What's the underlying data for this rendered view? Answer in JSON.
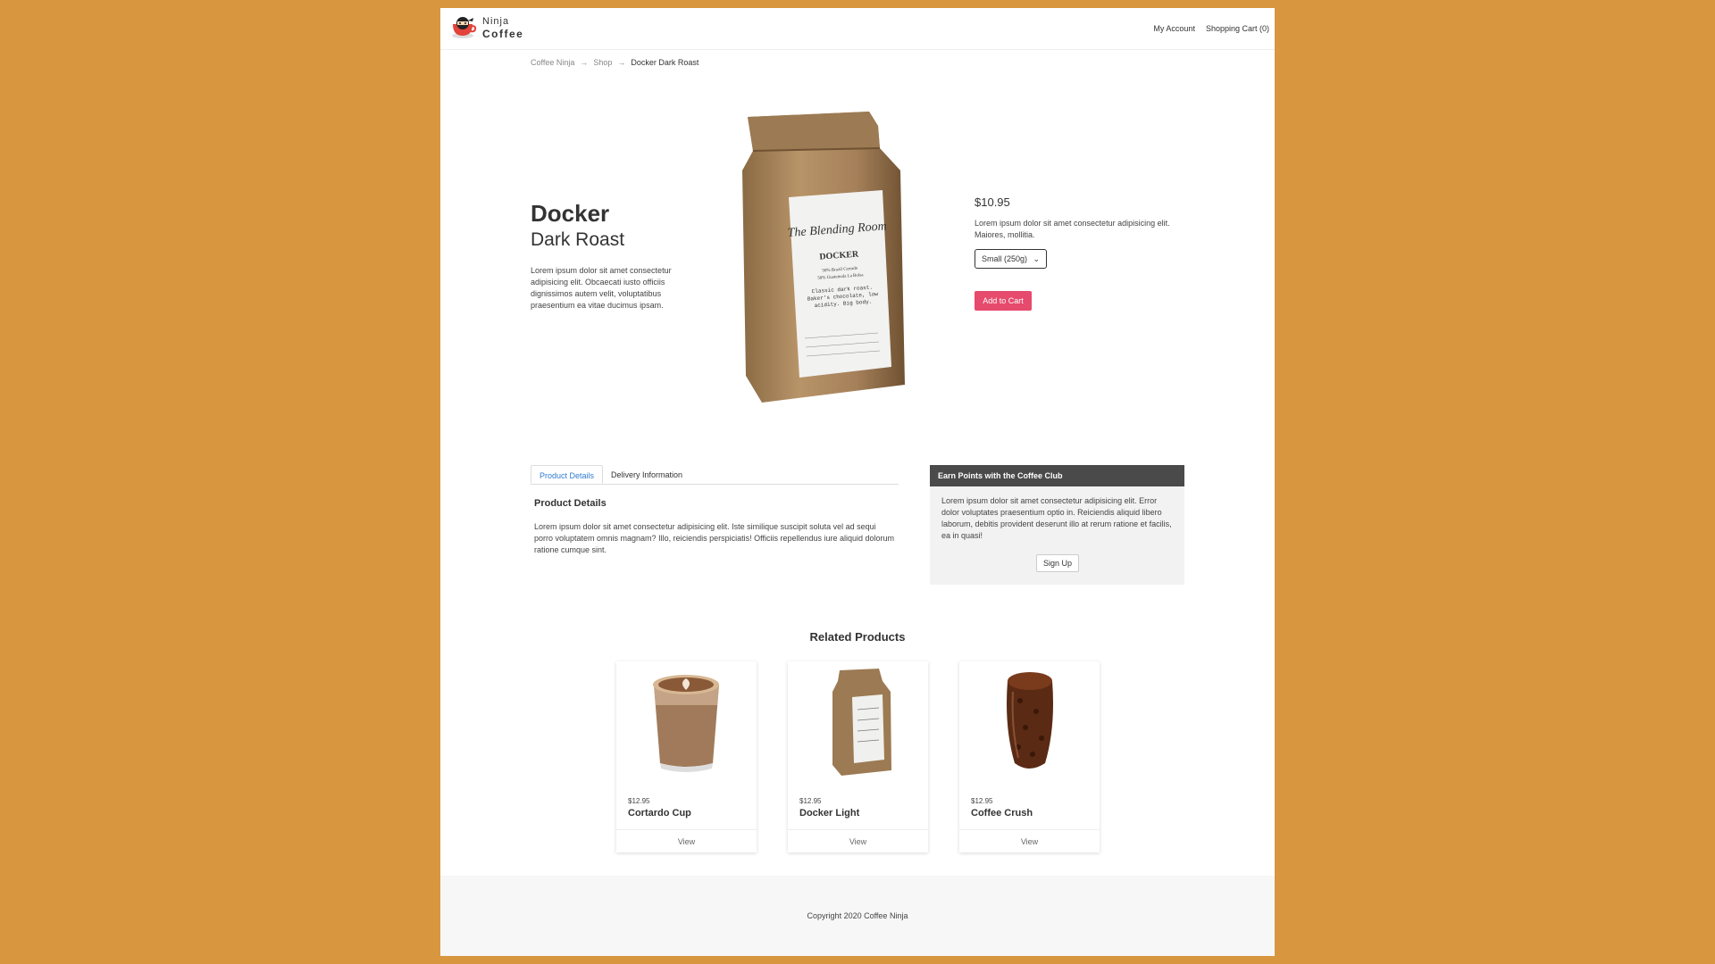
{
  "brand": {
    "line1": "Ninja",
    "line2": "Coffee"
  },
  "nav": {
    "account": "My Account",
    "cart": "Shopping Cart (0)"
  },
  "breadcrumb": {
    "home": "Coffee Ninja",
    "sep1": "→",
    "shop": "Shop",
    "sep2": "→",
    "current": "Docker Dark Roast"
  },
  "product": {
    "name_line1": "Docker",
    "name_line2": "Dark Roast",
    "description": "Lorem ipsum dolor sit amet consectetur adipisicing elit. Obcaecati iusto officiis dignissimos autem velit, voluptatibus praesentium ea vitae ducimus ipsam.",
    "price": "$10.95",
    "short_description": "Lorem ipsum dolor sit amet consectetur adipisicing elit. Maiores, mollitia.",
    "size_selected": "Small (250g)",
    "add_to_cart": "Add to Cart",
    "bag_label": {
      "script": "The Blending Room",
      "title": "DOCKER",
      "line1": "50% Brazil Cerrado",
      "line2": "50% Guatemala La Bolsa",
      "notes": "Classic dark roast. Baker's chocolate, low acidity. Big body."
    }
  },
  "tabs": {
    "details": "Product Details",
    "delivery": "Delivery Information"
  },
  "details": {
    "title": "Product Details",
    "text": "Lorem ipsum dolor sit amet consectetur adipisicing elit. Iste similique suscipit soluta vel ad sequi porro voluptatem omnis magnam? Illo, reiciendis perspiciatis! Officiis repellendus iure aliquid dolorum ratione cumque sint."
  },
  "club": {
    "title": "Earn Points with the Coffee Club",
    "text": "Lorem ipsum dolor sit amet consectetur adipisicing elit. Error dolor voluptates praesentium optio in. Reiciendis aliquid libero laborum, debitis provident deserunt illo at rerum ratione et facilis, ea in quasi!",
    "signup": "Sign Up"
  },
  "related": {
    "title": "Related Products",
    "items": [
      {
        "price": "$12.95",
        "name": "Cortardo Cup",
        "view": "View"
      },
      {
        "price": "$12.95",
        "name": "Docker Light",
        "view": "View"
      },
      {
        "price": "$12.95",
        "name": "Coffee Crush",
        "view": "View"
      }
    ]
  },
  "footer": {
    "copyright": "Copyright 2020 Coffee Ninja"
  },
  "colors": {
    "background": "#D8963F",
    "accent": "#E64A6C",
    "tab_active": "#2F7CD0",
    "club_header": "#4a4a4a"
  }
}
